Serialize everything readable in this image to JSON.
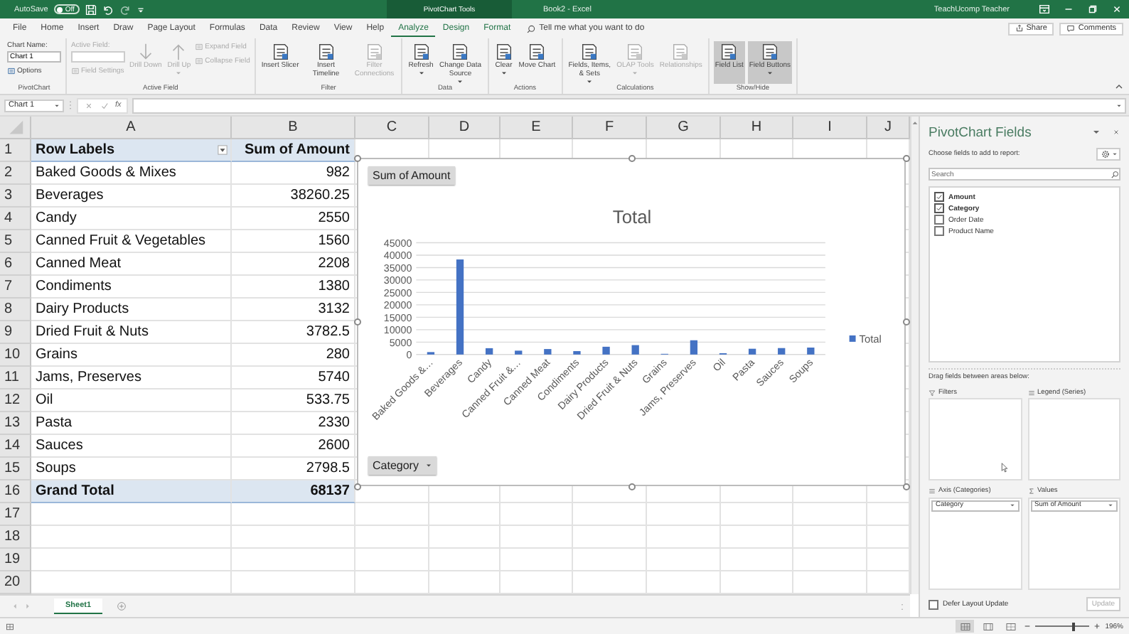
{
  "title_bar": {
    "autosave_label": "AutoSave",
    "autosave_state": "Off",
    "autosave_on": false,
    "context_title": "PivotChart Tools",
    "title": "Book2 - Excel",
    "user": "TeachUcomp Teacher"
  },
  "tabs": [
    {
      "label": "File",
      "selected": false,
      "contextual": false
    },
    {
      "label": "Home",
      "selected": false,
      "contextual": false
    },
    {
      "label": "Insert",
      "selected": false,
      "contextual": false
    },
    {
      "label": "Draw",
      "selected": false,
      "contextual": false
    },
    {
      "label": "Page Layout",
      "selected": false,
      "contextual": false
    },
    {
      "label": "Formulas",
      "selected": false,
      "contextual": false
    },
    {
      "label": "Data",
      "selected": false,
      "contextual": false
    },
    {
      "label": "Review",
      "selected": false,
      "contextual": false
    },
    {
      "label": "View",
      "selected": false,
      "contextual": false
    },
    {
      "label": "Help",
      "selected": false,
      "contextual": false
    },
    {
      "label": "Analyze",
      "selected": true,
      "contextual": true
    },
    {
      "label": "Design",
      "selected": false,
      "contextual": true
    },
    {
      "label": "Format",
      "selected": false,
      "contextual": true
    }
  ],
  "tell_me": {
    "placeholder": "Tell me what you want to do"
  },
  "share_button": "Share",
  "comments_button": "Comments",
  "ribbon": {
    "groups": [
      {
        "label": "PivotChart",
        "columns": [
          [
            {
              "kind": "namefield",
              "label": "Chart Name:",
              "value": "Chart 1",
              "disabled": false
            },
            {
              "kind": "small",
              "label": "Options",
              "disabled": false
            }
          ]
        ]
      },
      {
        "label": "Active Field",
        "columns": [
          [
            {
              "kind": "namefield",
              "label": "Active Field:",
              "disabled": true
            },
            {
              "kind": "small",
              "label": "Field Settings",
              "disabled": true
            }
          ],
          [
            {
              "kind": "drilldown",
              "label": "Drill Down",
              "disabled": true,
              "selected": false,
              "dropdown": false
            }
          ],
          [
            {
              "kind": "drillup",
              "label": "Drill Up",
              "disabled": true,
              "selected": false,
              "dropdown": true
            }
          ],
          [
            {
              "kind": "small",
              "label": "Expand Field",
              "disabled": true
            },
            {
              "kind": "small",
              "label": "Collapse Field",
              "disabled": true
            }
          ]
        ]
      },
      {
        "label": "Filter",
        "columns": [
          [
            {
              "kind": "large",
              "label": "Insert Slicer",
              "disabled": false,
              "selected": false,
              "dropdown": false
            }
          ],
          [
            {
              "kind": "large",
              "label": "Insert Timeline",
              "disabled": false,
              "selected": false,
              "dropdown": false
            }
          ],
          [
            {
              "kind": "large",
              "label": "Filter Connections",
              "disabled": true,
              "selected": false,
              "dropdown": false
            }
          ]
        ]
      },
      {
        "label": "Data",
        "columns": [
          [
            {
              "kind": "large",
              "label": "Refresh",
              "disabled": false,
              "selected": false,
              "dropdown": true
            }
          ],
          [
            {
              "kind": "large",
              "label": "Change Data Source",
              "disabled": false,
              "selected": false,
              "dropdown": true
            }
          ]
        ]
      },
      {
        "label": "Actions",
        "columns": [
          [
            {
              "kind": "large",
              "label": "Clear",
              "disabled": false,
              "selected": false,
              "dropdown": true
            }
          ],
          [
            {
              "kind": "large",
              "label": "Move Chart",
              "disabled": false,
              "selected": false,
              "dropdown": false
            }
          ]
        ]
      },
      {
        "label": "Calculations",
        "columns": [
          [
            {
              "kind": "large",
              "label": "Fields, Items, & Sets",
              "disabled": false,
              "selected": false,
              "dropdown": true
            }
          ],
          [
            {
              "kind": "large",
              "label": "OLAP Tools",
              "disabled": true,
              "selected": false,
              "dropdown": true
            }
          ],
          [
            {
              "kind": "large",
              "label": "Relationships",
              "disabled": true,
              "selected": false,
              "dropdown": false
            }
          ]
        ]
      },
      {
        "label": "Show/Hide",
        "columns": [
          [
            {
              "kind": "large",
              "label": "Field List",
              "disabled": false,
              "selected": true,
              "dropdown": false
            }
          ],
          [
            {
              "kind": "large",
              "label": "Field Buttons",
              "disabled": false,
              "selected": true,
              "dropdown": true
            }
          ]
        ]
      }
    ]
  },
  "formula_bar": {
    "name_box": "Chart 1",
    "function_label": "fx"
  },
  "sheet": {
    "columns": [
      "A",
      "B",
      "C",
      "D",
      "E",
      "F",
      "G",
      "H",
      "I",
      "J"
    ],
    "row_numbers": [
      "1",
      "2",
      "3",
      "4",
      "5",
      "6",
      "7",
      "8",
      "9",
      "10",
      "11",
      "12",
      "13",
      "14",
      "15",
      "16",
      "17",
      "18",
      "19",
      "20"
    ],
    "pivot": {
      "header": [
        "Row Labels",
        "Sum of Amount"
      ],
      "rows": [
        {
          "label": "Baked Goods & Mixes",
          "value": "982"
        },
        {
          "label": "Beverages",
          "value": "38260.25"
        },
        {
          "label": "Candy",
          "value": "2550"
        },
        {
          "label": "Canned Fruit & Vegetables",
          "value": "1560"
        },
        {
          "label": "Canned Meat",
          "value": "2208"
        },
        {
          "label": "Condiments",
          "value": "1380"
        },
        {
          "label": "Dairy Products",
          "value": "3132"
        },
        {
          "label": "Dried Fruit & Nuts",
          "value": "3782.5"
        },
        {
          "label": "Grains",
          "value": "280"
        },
        {
          "label": "Jams, Preserves",
          "value": "5740"
        },
        {
          "label": "Oil",
          "value": "533.75"
        },
        {
          "label": "Pasta",
          "value": "2330"
        },
        {
          "label": "Sauces",
          "value": "2600"
        },
        {
          "label": "Soups",
          "value": "2798.5"
        }
      ],
      "total": {
        "label": "Grand Total",
        "value": "68137"
      }
    }
  },
  "chart": {
    "value_button": "Sum of Amount",
    "axis_button": "Category",
    "chart_data": {
      "type": "bar",
      "title": "Total",
      "categories": [
        "Baked Goods &…",
        "Beverages",
        "Candy",
        "Canned Fruit &…",
        "Canned Meat",
        "Condiments",
        "Dairy Products",
        "Dried Fruit & Nuts",
        "Grains",
        "Jams, Preserves",
        "Oil",
        "Pasta",
        "Sauces",
        "Soups"
      ],
      "series": [
        {
          "name": "Total",
          "color": "#4472c4",
          "values": [
            982,
            38260.25,
            2550,
            1560,
            2208,
            1380,
            3132,
            3782.5,
            280,
            5740,
            533.75,
            2330,
            2600,
            2798.5
          ]
        }
      ],
      "grid": true,
      "ylim": [
        0,
        45000
      ],
      "yticks": [
        0,
        5000,
        10000,
        15000,
        20000,
        25000,
        30000,
        35000,
        40000,
        45000
      ]
    }
  },
  "sheet_tabs": [
    {
      "label": "Sheet1",
      "selected": true
    }
  ],
  "field_pane": {
    "title": "PivotChart Fields",
    "subtitle": "Choose fields to add to report:",
    "search": {
      "placeholder": "Search"
    },
    "fields": [
      {
        "label": "Amount",
        "checked": true
      },
      {
        "label": "Category",
        "checked": true
      },
      {
        "label": "Order Date",
        "checked": false
      },
      {
        "label": "Product Name",
        "checked": false
      }
    ],
    "areas_hint": "Drag fields between areas below:",
    "areas": [
      {
        "title": "Filters",
        "kind": "filter"
      },
      {
        "title": "Legend (Series)",
        "kind": "legend"
      },
      {
        "title": "Axis (Categories)",
        "kind": "axis",
        "items": [
          "Category"
        ]
      },
      {
        "title": "Values",
        "kind": "values",
        "items": [
          "Sum of Amount"
        ]
      }
    ],
    "defer": {
      "label": "Defer Layout Update",
      "checked": false
    },
    "update_button": {
      "label": "Update",
      "disabled": true
    }
  },
  "status_bar": {
    "views": [
      {
        "kind": "normal",
        "selected": true
      },
      {
        "kind": "layout",
        "selected": false
      },
      {
        "kind": "pagebreak",
        "selected": false
      }
    ],
    "zoom_slider": {
      "level": 0.7
    },
    "zoom": "196%"
  }
}
